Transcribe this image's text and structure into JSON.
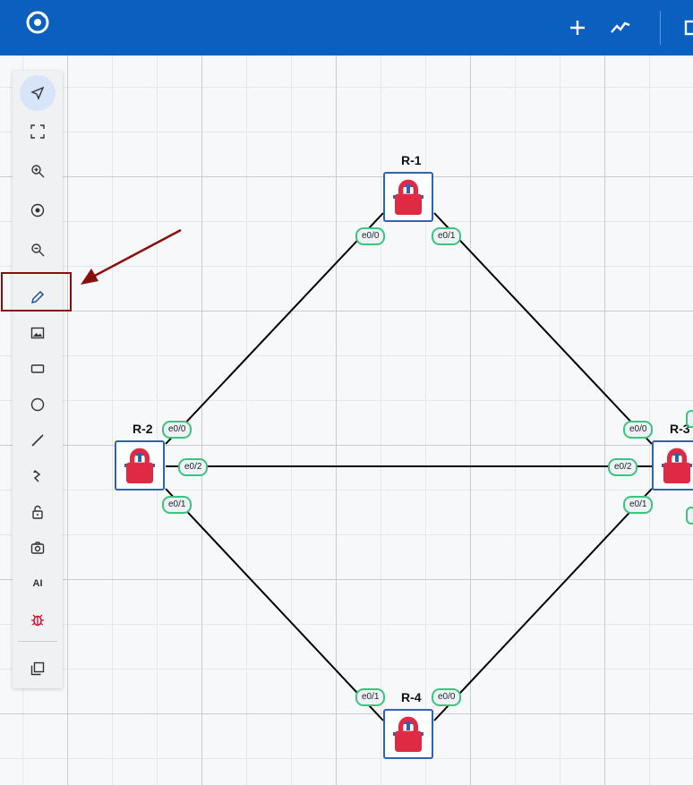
{
  "topbar": {
    "icons": [
      "app-logo-icon",
      "plus-icon",
      "activity-chart-icon",
      "window-icon"
    ]
  },
  "toolbar": {
    "tools": [
      {
        "name": "select",
        "icon": "navigate-arrow-icon",
        "active": true
      },
      {
        "name": "fit-to-screen",
        "icon": "fit-screen-icon"
      },
      {
        "name": "zoom-in",
        "icon": "zoom-in-icon"
      },
      {
        "name": "center",
        "icon": "center-target-icon"
      },
      {
        "name": "zoom-out",
        "icon": "zoom-out-icon"
      },
      {
        "name": "draw",
        "icon": "pencil-icon",
        "highlighted": true
      },
      {
        "name": "insert-image",
        "icon": "image-icon"
      },
      {
        "name": "rectangle",
        "icon": "rectangle-icon"
      },
      {
        "name": "ellipse",
        "icon": "circle-icon"
      },
      {
        "name": "line",
        "icon": "line-icon"
      },
      {
        "name": "curve",
        "icon": "curved-arrow-icon"
      },
      {
        "name": "lock",
        "icon": "unlock-icon"
      },
      {
        "name": "screenshot",
        "icon": "camera-icon"
      },
      {
        "name": "ai",
        "label": "AI"
      },
      {
        "name": "debug",
        "icon": "bug-icon"
      },
      {
        "name": "layers",
        "icon": "layers-icon"
      }
    ]
  },
  "nodes": {
    "r1": {
      "label": "R-1",
      "ports": {
        "a": "e0/0",
        "b": "e0/1"
      }
    },
    "r2": {
      "label": "R-2",
      "ports": {
        "a": "e0/0",
        "b": "e0/2",
        "c": "e0/1"
      }
    },
    "r3": {
      "label": "R-3",
      "ports": {
        "a": "e0/0",
        "b": "e0/2",
        "c": "e0/1"
      }
    },
    "r4": {
      "label": "R-4",
      "ports": {
        "a": "e0/1",
        "b": "e0/0"
      }
    }
  },
  "colors": {
    "topbar": "#0a5fbf",
    "node_border": "#2f63ad",
    "port_border": "#3cc47c",
    "lock": "#e02a44",
    "annotation": "#8b0e0e"
  }
}
